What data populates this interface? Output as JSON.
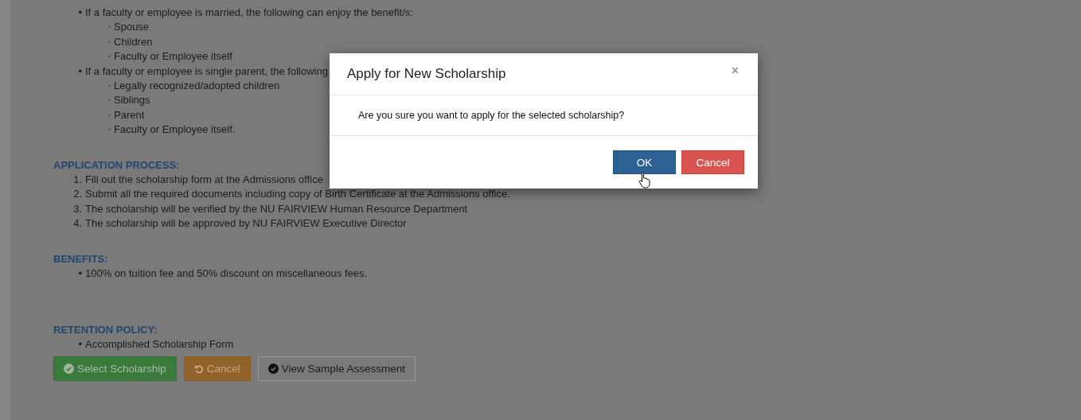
{
  "eligibility": {
    "items": [
      {
        "marker": "•",
        "text": "If a faculty or employee is married, the following can enjoy the benefit/s:",
        "children": [
          {
            "marker": "◦",
            "text": "Spouse"
          },
          {
            "marker": "◦",
            "text": "Children"
          },
          {
            "marker": "◦",
            "text": "Faculty or Employee itself"
          }
        ]
      },
      {
        "marker": "•",
        "text": "If a faculty or employee is single parent, the following",
        "children": [
          {
            "marker": "◦",
            "text": "Legally recognized/adopted children"
          },
          {
            "marker": "◦",
            "text": "Siblings"
          },
          {
            "marker": "◦",
            "text": "Parent"
          },
          {
            "marker": "◦",
            "text": "Faculty or Employee itself."
          }
        ]
      }
    ]
  },
  "sections": [
    {
      "heading": "APPLICATION PROCESS:",
      "items": [
        {
          "marker": "1.",
          "text": "Fill out the scholarship form at the Admissions office"
        },
        {
          "marker": "2.",
          "text": "Submit all the required documents including copy of Birth Certificate at the Admissions office."
        },
        {
          "marker": "3.",
          "text": "The scholarship will be verified by the NU FAIRVIEW Human Resource Department"
        },
        {
          "marker": "4.",
          "text": "The scholarship will be approved by NU FAIRVIEW Executive Director"
        }
      ]
    },
    {
      "heading": "BENEFITS:",
      "items": [
        {
          "marker": "•",
          "text": "100% on tuition fee and 50% discount on miscellaneous fees."
        }
      ]
    },
    {
      "heading": "RETENTION POLICY:",
      "items": [
        {
          "marker": "•",
          "text": "Accomplished Scholarship Form"
        }
      ]
    }
  ],
  "actions": [
    {
      "label": "Select Scholarship",
      "kind": "success"
    },
    {
      "label": "Cancel",
      "kind": "warning"
    },
    {
      "label": "View Sample Assessment",
      "kind": "default"
    }
  ],
  "modal": {
    "title": "Apply for New Scholarship",
    "close": "×",
    "message": "Are you sure you want to apply for the selected scholarship?",
    "buttons": [
      {
        "label": "OK",
        "kind": "primary"
      },
      {
        "label": "Cancel",
        "kind": "danger"
      }
    ]
  }
}
